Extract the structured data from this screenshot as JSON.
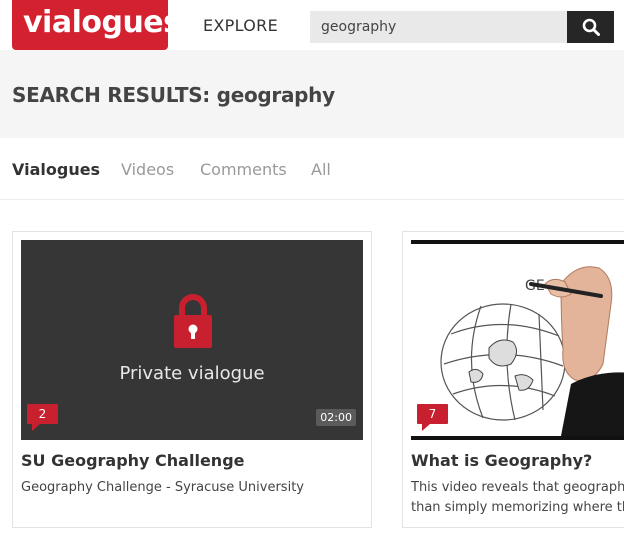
{
  "header": {
    "logo_text": "vialogues",
    "nav_explore": "EXPLORE",
    "search_value": "geography",
    "search_icon": "search-icon"
  },
  "banner": {
    "title": "SEARCH RESULTS: geography"
  },
  "tabs": [
    {
      "label": "Vialogues",
      "active": true
    },
    {
      "label": "Videos",
      "active": false
    },
    {
      "label": "Comments",
      "active": false
    },
    {
      "label": "All",
      "active": false
    }
  ],
  "results": [
    {
      "private_label": "Private vialogue",
      "comment_count": "2",
      "duration": "02:00",
      "title": "SU Geography Challenge",
      "description": "Geography Challenge - Syracuse University"
    },
    {
      "comment_count": "7",
      "title": "What is Geography?",
      "description_line1": "This video reveals that geography",
      "description_line2": "than simply memorizing where th"
    }
  ],
  "colors": {
    "brand_red": "#d42130",
    "search_button": "#262626",
    "thumb_dark": "#363636"
  }
}
